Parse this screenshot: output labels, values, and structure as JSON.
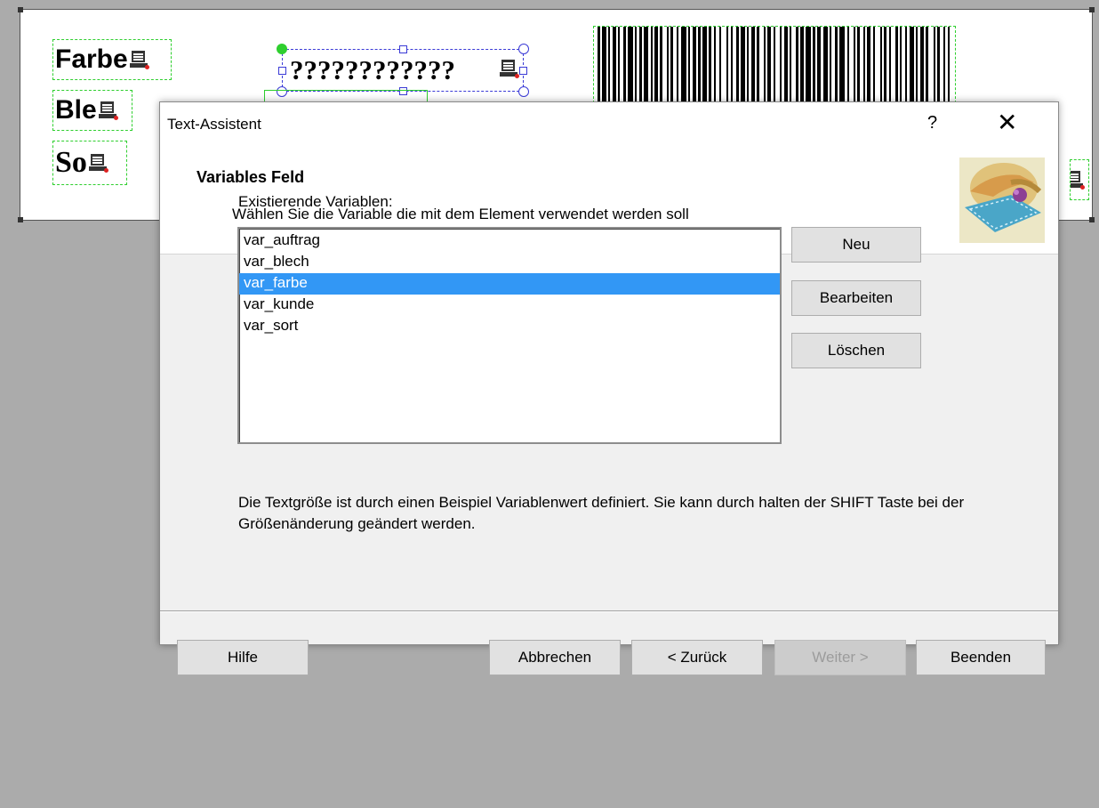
{
  "canvas": {
    "fields": [
      {
        "id": "farbe",
        "text": "Farbe"
      },
      {
        "id": "blech",
        "text": "Ble"
      },
      {
        "id": "sort",
        "text": "So"
      }
    ],
    "selected_field_text": "????????????"
  },
  "dialog": {
    "title": "Text-Assistent",
    "help_glyph": "?",
    "close_glyph": "✕",
    "header_title": "Variables Feld",
    "header_subtitle": "Wählen Sie die Variable die mit dem Element verwendet werden soll",
    "list_label": "Existierende Variablen:",
    "variables": [
      {
        "name": "var_auftrag"
      },
      {
        "name": "var_blech"
      },
      {
        "name": "var_farbe",
        "selected": true
      },
      {
        "name": "var_kunde"
      },
      {
        "name": "var_sort"
      }
    ],
    "side_buttons": {
      "new": "Neu",
      "edit": "Bearbeiten",
      "delete": "Löschen"
    },
    "note": "Die Textgröße ist durch einen Beispiel Variablenwert definiert. Sie kann durch halten der SHIFT Taste bei der Größenänderung geändert werden.",
    "footer_buttons": {
      "help": "Hilfe",
      "cancel": "Abbrechen",
      "back": "< Zurück",
      "next": "Weiter >",
      "finish": "Beenden"
    },
    "next_disabled": true,
    "colors": {
      "selection": "#3297f5",
      "field_border": "#2fcf2f",
      "handle": "#3a3ad6"
    }
  }
}
